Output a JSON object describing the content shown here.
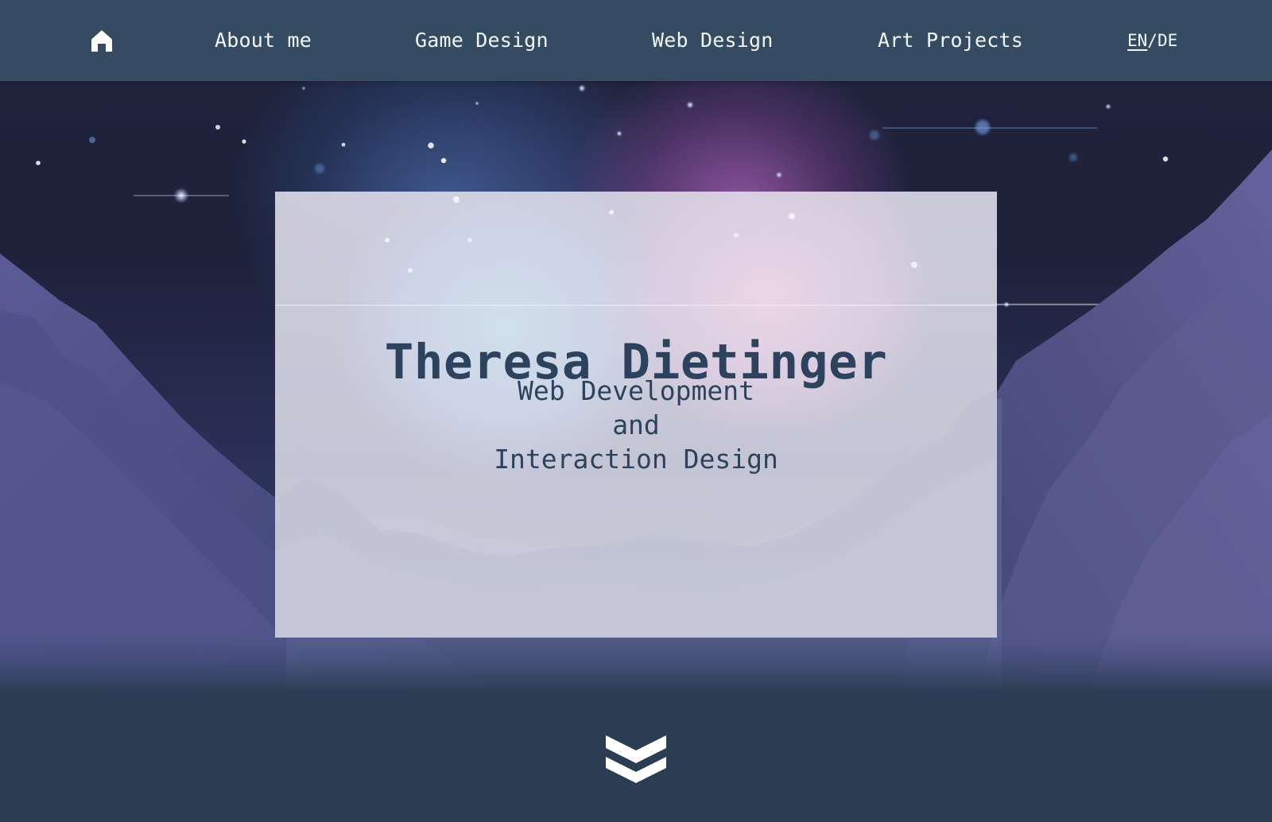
{
  "header": {
    "home_icon": "home-icon",
    "nav": [
      {
        "label": "About me"
      },
      {
        "label": "Game Design"
      },
      {
        "label": "Web Design"
      },
      {
        "label": "Art Projects"
      }
    ],
    "language": {
      "active": "EN",
      "separator": "/",
      "other": "DE"
    }
  },
  "hero": {
    "name": "Theresa Dietinger",
    "subtitle_lines": [
      "Web Development",
      "and",
      "Interaction Design"
    ]
  },
  "scroll": {
    "icon": "double-chevron-down-icon"
  },
  "colors": {
    "header_background": "#354b62",
    "footer_background": "#2a3d52",
    "hero_text": "#2d435d",
    "nav_text": "#f3f6fb"
  }
}
